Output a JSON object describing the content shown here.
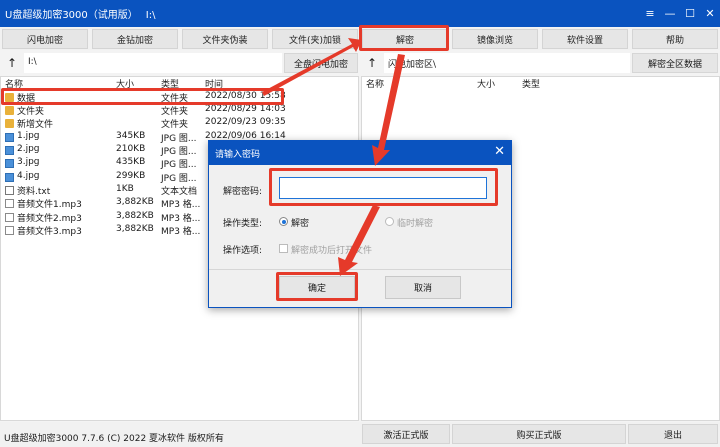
{
  "window": {
    "title": "U盘超级加密3000（试用版）",
    "path": "I:\\",
    "controls": {
      "menu": "≡",
      "minimize": "—",
      "maximize": "☐",
      "close": "✕"
    }
  },
  "toolbar": {
    "buttons": [
      "闪电加密",
      "金钻加密",
      "文件夹伪装",
      "文件(夹)加锁",
      "解密",
      "镜像浏览",
      "软件设置",
      "帮助"
    ]
  },
  "left_pane": {
    "path": "I:\\",
    "action_button": "全盘闪电加密",
    "columns": [
      "名称",
      "大小",
      "类型",
      "时间"
    ],
    "rows": [
      {
        "icon": "folder-icon",
        "name": "数据",
        "size": "",
        "type": "文件夹",
        "time": "2022/08/30 15:58"
      },
      {
        "icon": "folder-icon",
        "name": "文件夹",
        "size": "",
        "type": "文件夹",
        "time": "2022/08/29 14:03"
      },
      {
        "icon": "folder-icon",
        "name": "新增文件",
        "size": "",
        "type": "文件夹",
        "time": "2022/09/23 09:35"
      },
      {
        "icon": "image-file-icon",
        "name": "1.jpg",
        "size": "345KB",
        "type": "JPG 图...",
        "time": "2022/09/06 16:14"
      },
      {
        "icon": "image-file-icon",
        "name": "2.jpg",
        "size": "210KB",
        "type": "JPG 图...",
        "time": ""
      },
      {
        "icon": "image-file-icon",
        "name": "3.jpg",
        "size": "435KB",
        "type": "JPG 图...",
        "time": ""
      },
      {
        "icon": "image-file-icon",
        "name": "4.jpg",
        "size": "299KB",
        "type": "JPG 图...",
        "time": ""
      },
      {
        "icon": "text-file-icon",
        "name": "资料.txt",
        "size": "1KB",
        "type": "文本文档",
        "time": ""
      },
      {
        "icon": "audio-file-icon",
        "name": "音频文件1.mp3",
        "size": "3,882KB",
        "type": "MP3 格...",
        "time": ""
      },
      {
        "icon": "audio-file-icon",
        "name": "音频文件2.mp3",
        "size": "3,882KB",
        "type": "MP3 格...",
        "time": ""
      },
      {
        "icon": "audio-file-icon",
        "name": "音频文件3.mp3",
        "size": "3,882KB",
        "type": "MP3 格...",
        "time": ""
      }
    ]
  },
  "right_pane": {
    "path": "闪电加密区\\",
    "action_button": "解密全区数据",
    "columns": [
      "名称",
      "大小",
      "类型"
    ]
  },
  "dialog": {
    "title": "请输入密码",
    "close": "✕",
    "password_label": "解密密码:",
    "password_value": "",
    "op_type_label": "操作类型:",
    "op_type_options": [
      "解密",
      "临时解密"
    ],
    "op_option_label": "操作选项:",
    "checkbox_label": "解密成功后打开文件",
    "ok": "确定",
    "cancel": "取消"
  },
  "status": {
    "text": "U盘超级加密3000 7.7.6 (C) 2022 夏冰软件 版权所有",
    "buttons": [
      "激活正式版",
      "购买正式版",
      "退出"
    ]
  },
  "colors": {
    "titlebar": "#0a53bf",
    "highlight": "#e53a2a",
    "accent": "#1e73d8"
  }
}
